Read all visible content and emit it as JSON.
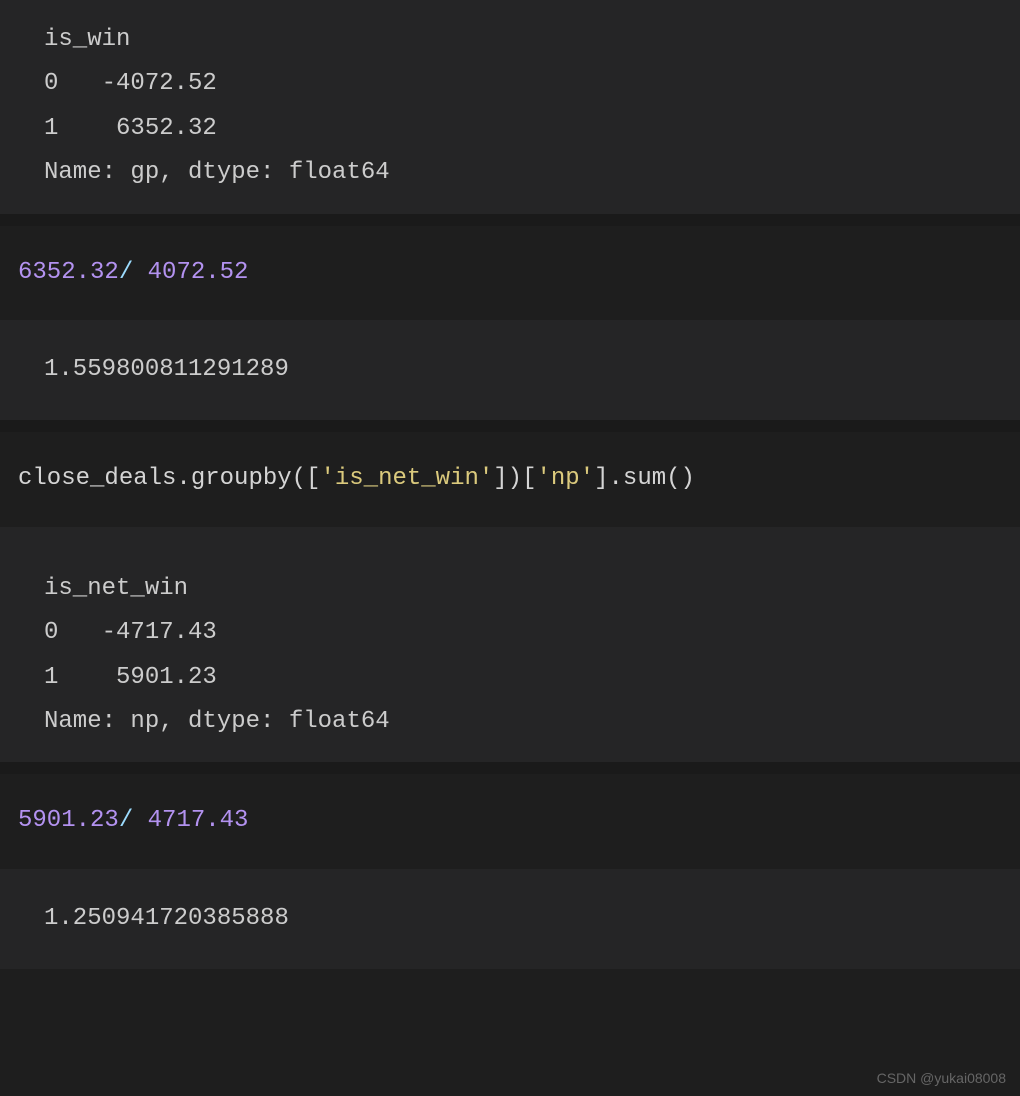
{
  "cells": {
    "out1_line1": "is_win",
    "out1_line2": "0   -4072.52",
    "out1_line3": "1    6352.32",
    "out1_line4": "Name: gp, dtype: float64",
    "in2_num1": "6352.32",
    "in2_op": "/",
    "in2_num2": " 4072.52",
    "out2_line1": "1.559800811291289",
    "in3_part1": "close_deals.groupby([",
    "in3_str1": "'is_net_win'",
    "in3_part2": "])[",
    "in3_str2": "'np'",
    "in3_part3": "].sum()",
    "out3_line1": "is_net_win",
    "out3_line2": "0   -4717.43",
    "out3_line3": "1    5901.23",
    "out3_line4": "Name: np, dtype: float64",
    "in4_num1": "5901.23",
    "in4_op": "/",
    "in4_num2": " 4717.43",
    "out4_line1": "1.250941720385888"
  },
  "watermark": "CSDN @yukai08008"
}
